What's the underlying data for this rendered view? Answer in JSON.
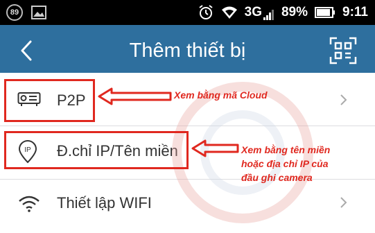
{
  "status_bar": {
    "notification_badge": "89",
    "network": "3G",
    "battery": "89%",
    "time": "9:11",
    "icons": [
      "image-icon",
      "alarm-icon",
      "wifi-icon",
      "signal-icon",
      "battery-icon"
    ]
  },
  "header": {
    "title": "Thêm thiết bị",
    "back_icon": "chevron-left-icon",
    "qr_icon": "qr-scan-icon",
    "background": "#2e6f9e"
  },
  "list": {
    "items": [
      {
        "label": "P2P",
        "icon": "projector-device-icon"
      },
      {
        "label": "Đ.chỉ IP/Tên miền",
        "icon": "ip-location-icon"
      },
      {
        "label": "Thiết lập WIFI",
        "icon": "wifi-icon"
      }
    ]
  },
  "annotations": {
    "p2p_note": "Xem bằng mã Cloud",
    "ip_note_line1": "Xem bằng tên miền",
    "ip_note_line2": "hoặc địa chỉ IP của",
    "ip_note_line3": "đầu ghi camera",
    "color": "#e0281f"
  }
}
